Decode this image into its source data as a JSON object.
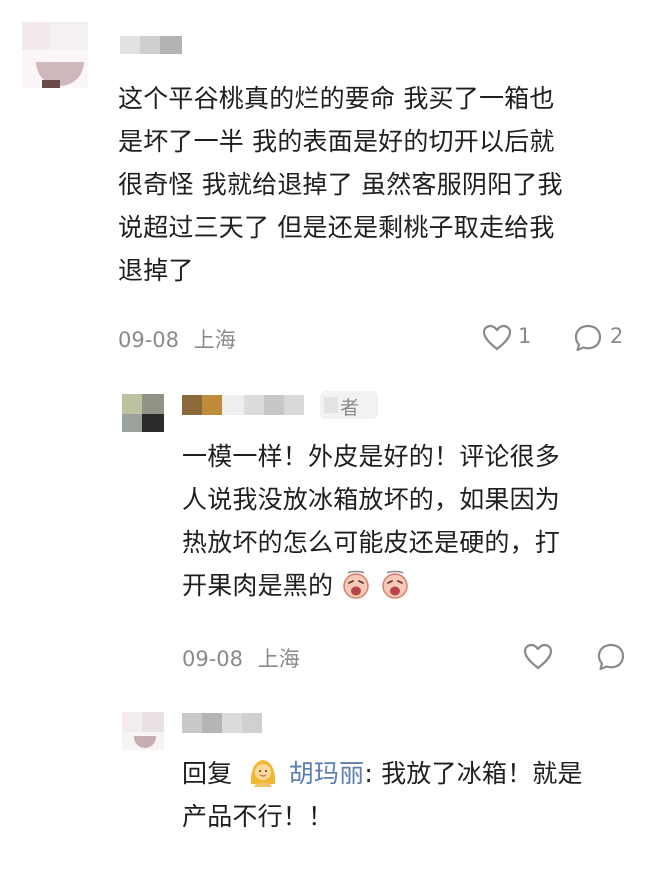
{
  "comments": [
    {
      "text": "这个平谷桃真的烂的要命 我买了一箱也是坏了一半 我的表面是好的切开以后就很奇怪 我就给退掉了 虽然客服阴阳了我说超过三天了 但是还是剩桃子取走给我退掉了",
      "lines": [
        "这个平谷桃真的烂的要命 我买了一箱也",
        "是坏了一半 我的表面是好的切开以后就",
        "很奇怪 我就给退掉了 虽然客服阴阳了我",
        "说超过三天了 但是还是剩桃子取走给我",
        "退掉了"
      ],
      "date": "09-08",
      "location": "上海",
      "like_count": "1",
      "reply_count": "2"
    },
    {
      "badge_partial": "者",
      "lines": [
        "一模一样！外皮是好的！评论很多",
        "人说我没放冰箱放坏的，如果因为",
        "热放坏的怎么可能皮还是硬的，打",
        "开果肉是黑的"
      ],
      "emoji_icon": "crying-face-emoji",
      "date": "09-08",
      "location": "上海"
    },
    {
      "reply_prefix": "回复",
      "reply_to_name": "胡玛丽",
      "reply_colon": ":",
      "lines_first": "我放了冰箱！就是",
      "line_second": "产品不行！！"
    }
  ],
  "icons": {
    "like": "heart-outline-icon",
    "reply": "speech-bubble-icon",
    "avatar_emoji": "person-emoji-icon"
  },
  "colors": {
    "meta_gray": "#8a8a8a",
    "name_blue": "#5b7fb0"
  }
}
